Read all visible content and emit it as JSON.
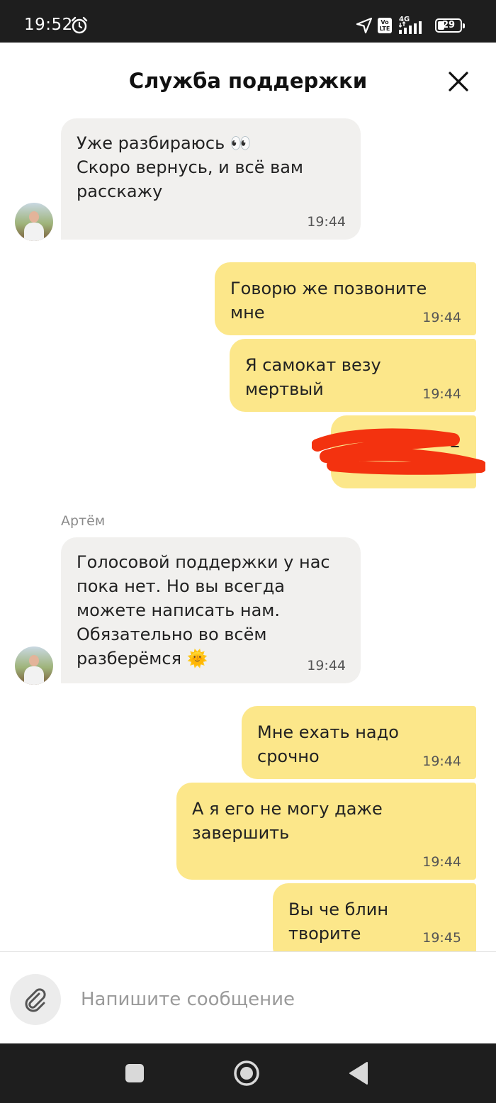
{
  "status_bar": {
    "time": "19:52",
    "network": "4G",
    "volte_label": "Vo\nLTE",
    "battery_level": "29",
    "battery_fraction": 0.29
  },
  "header": {
    "title": "Служба поддержки",
    "close_icon": "close-icon"
  },
  "messages": [
    {
      "direction": "in",
      "text": "Уже разбираюсь 👀\nСкоро вернусь, и всё вам расскажу",
      "time": "19:44"
    },
    {
      "direction": "out",
      "text": "Говорю же позвоните мне",
      "time": "19:44"
    },
    {
      "direction": "out",
      "text": "Я самокат везу мертвый",
      "time": "19:44"
    },
    {
      "direction": "out",
      "text": "2",
      "time": "",
      "redacted": true
    },
    {
      "direction": "in",
      "sender": "Артём",
      "text": "Голосовой поддержки у нас пока нет. Но вы всегда можете написать нам. Обязательно во всём разберёмся 🌞",
      "time": "19:44"
    },
    {
      "direction": "out",
      "text": "Мне ехать надо срочно",
      "time": "19:44"
    },
    {
      "direction": "out",
      "text": "А я его не могу даже завершить",
      "time": "19:44"
    },
    {
      "direction": "out",
      "text": "Вы че блин творите",
      "time": "19:45"
    }
  ],
  "composer": {
    "placeholder": "Напишите сообщение",
    "value": "",
    "attach_icon": "paperclip-icon"
  },
  "nav_bar": {
    "buttons": [
      "recents-icon",
      "home-icon",
      "back-icon"
    ]
  },
  "colors": {
    "outgoing_bubble": "#fce78a",
    "incoming_bubble": "#f1f0ee",
    "system_bar": "#1e1e1e"
  }
}
